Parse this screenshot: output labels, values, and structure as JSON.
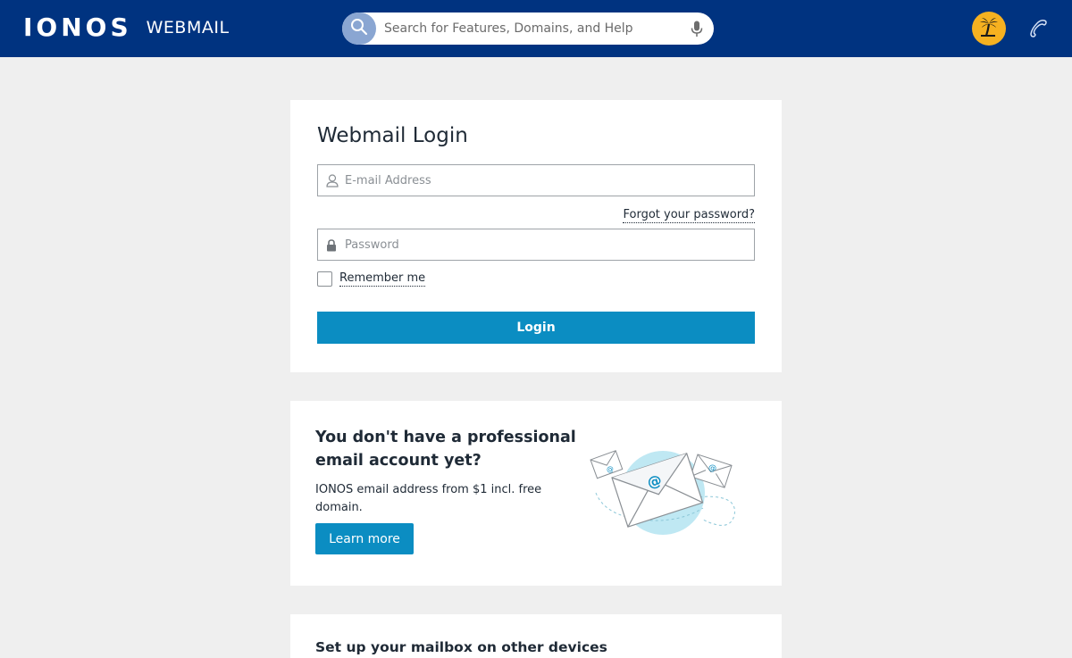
{
  "header": {
    "brand": "IONOS",
    "product": "WEBMAIL",
    "search_placeholder": "Search for Features, Domains, and Help",
    "icons": [
      "search-icon",
      "microphone-icon",
      "palm-tree-icon",
      "phone-icon"
    ],
    "colors": {
      "bar": "#003380",
      "avatar": "#f6b120"
    }
  },
  "login": {
    "title": "Webmail Login",
    "email_placeholder": "E-mail Address",
    "forgot_link": "Forgot your password?",
    "password_placeholder": "Password",
    "remember_label": "Remember me",
    "remember_checked": false,
    "button_label": "Login",
    "accent": "#0b8dc2"
  },
  "promo": {
    "title": "You don't have a professional email account yet?",
    "text": "IONOS email address from $1 incl. free domain.",
    "button_label": "Learn more"
  },
  "devices": {
    "title": "Set up your mailbox on other devices"
  }
}
